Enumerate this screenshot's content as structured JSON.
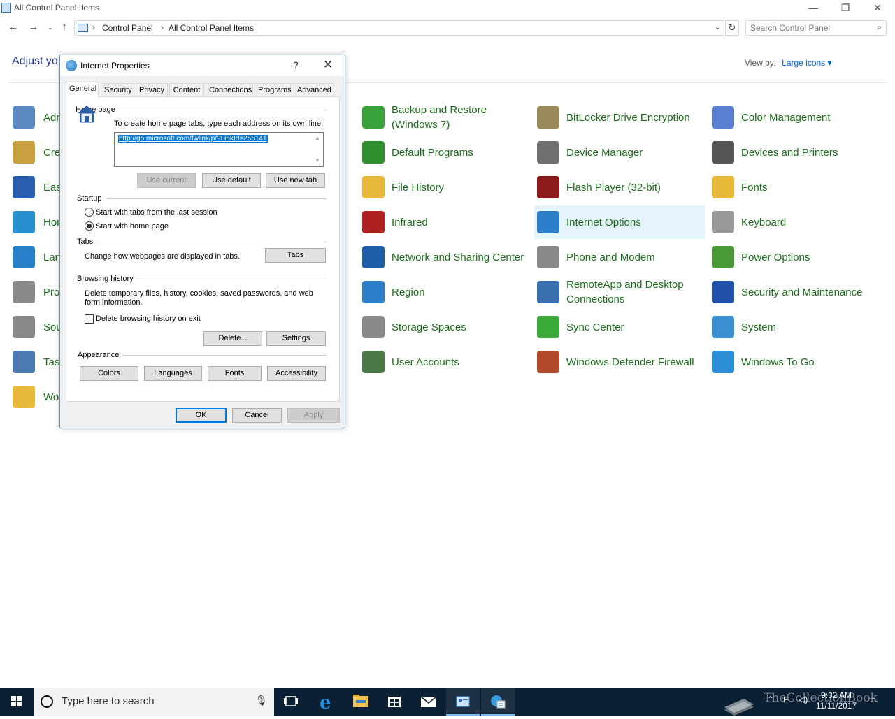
{
  "window": {
    "title": "All Control Panel Items",
    "minimize": "—",
    "restore": "❐",
    "close": "✕"
  },
  "address": {
    "crumbs": [
      "Control Panel",
      "All Control Panel Items"
    ],
    "search_placeholder": "Search Control Panel"
  },
  "heading": "Adjust yo",
  "view_by": {
    "label": "View by:",
    "value": "Large icons ▾"
  },
  "left_items": [
    "Adr",
    "Cre",
    "Eas",
    "Hor",
    "Lan",
    "Pro",
    "Sou",
    "Tas",
    "Wo"
  ],
  "items": [
    {
      "label": "Backup and Restore (Windows 7)",
      "icon": "backup-restore-icon",
      "color": "#3aa23a"
    },
    {
      "label": "BitLocker Drive Encryption",
      "icon": "bitlocker-icon",
      "color": "#9a8a5a"
    },
    {
      "label": "Color Management",
      "icon": "color-management-icon",
      "color": "#5a7fd0"
    },
    {
      "label": "Default Programs",
      "icon": "default-programs-icon",
      "color": "#2f8f2f"
    },
    {
      "label": "Device Manager",
      "icon": "device-manager-icon",
      "color": "#707070"
    },
    {
      "label": "Devices and Printers",
      "icon": "devices-printers-icon",
      "color": "#555555"
    },
    {
      "label": "File History",
      "icon": "file-history-icon",
      "color": "#e8b93b"
    },
    {
      "label": "Flash Player (32-bit)",
      "icon": "flash-player-icon",
      "color": "#8b1a1a"
    },
    {
      "label": "Fonts",
      "icon": "fonts-icon",
      "color": "#e8b93b"
    },
    {
      "label": "Infrared",
      "icon": "infrared-icon",
      "color": "#b02020"
    },
    {
      "label": "Internet Options",
      "icon": "internet-options-icon",
      "color": "#2d7fc9"
    },
    {
      "label": "Keyboard",
      "icon": "keyboard-icon",
      "color": "#999999"
    },
    {
      "label": "Network and Sharing Center",
      "icon": "network-sharing-icon",
      "color": "#1f5fa8"
    },
    {
      "label": "Phone and Modem",
      "icon": "phone-modem-icon",
      "color": "#8a8a8a"
    },
    {
      "label": "Power Options",
      "icon": "power-options-icon",
      "color": "#4a9a3a"
    },
    {
      "label": "Region",
      "icon": "region-icon",
      "color": "#2d7fc9"
    },
    {
      "label": "RemoteApp and Desktop Connections",
      "icon": "remoteapp-icon",
      "color": "#3a6fb0"
    },
    {
      "label": "Security and Maintenance",
      "icon": "security-maintenance-icon",
      "color": "#2050a8"
    },
    {
      "label": "Storage Spaces",
      "icon": "storage-spaces-icon",
      "color": "#8a8a8a"
    },
    {
      "label": "Sync Center",
      "icon": "sync-center-icon",
      "color": "#3aaa3a"
    },
    {
      "label": "System",
      "icon": "system-icon",
      "color": "#3a8fd0"
    },
    {
      "label": "User Accounts",
      "icon": "user-accounts-icon",
      "color": "#4a7a4a"
    },
    {
      "label": "Windows Defender Firewall",
      "icon": "firewall-icon",
      "color": "#b04a2a"
    },
    {
      "label": "Windows To Go",
      "icon": "windows-to-go-icon",
      "color": "#2d8fd8"
    }
  ],
  "dialog": {
    "title": "Internet Properties",
    "help": "?",
    "close": "✕",
    "tabs": [
      "General",
      "Security",
      "Privacy",
      "Content",
      "Connections",
      "Programs",
      "Advanced"
    ],
    "home_page": {
      "group": "Home page",
      "instructions": "To create home page tabs, type each address on its own line.",
      "url": "http://go.microsoft.com/fwlink/p/?LinkId=255141",
      "use_current": "Use current",
      "use_default": "Use default",
      "use_new_tab": "Use new tab"
    },
    "startup": {
      "group": "Startup",
      "option1": "Start with tabs from the last session",
      "option2": "Start with home page"
    },
    "tabs_group": {
      "group": "Tabs",
      "text": "Change how webpages are displayed in tabs.",
      "button": "Tabs"
    },
    "history": {
      "group": "Browsing history",
      "text": "Delete temporary files, history, cookies, saved passwords, and web form information.",
      "checkbox": "Delete browsing history on exit",
      "delete": "Delete...",
      "settings": "Settings"
    },
    "appearance": {
      "group": "Appearance",
      "colors": "Colors",
      "languages": "Languages",
      "fonts": "Fonts",
      "accessibility": "Accessibility"
    },
    "ok": "OK",
    "cancel": "Cancel",
    "apply": "Apply"
  },
  "taskbar": {
    "search_placeholder": "Type here to search",
    "time": "9:32 AM",
    "date": "11/11/2017",
    "watermark": "TheCollectionBook"
  }
}
